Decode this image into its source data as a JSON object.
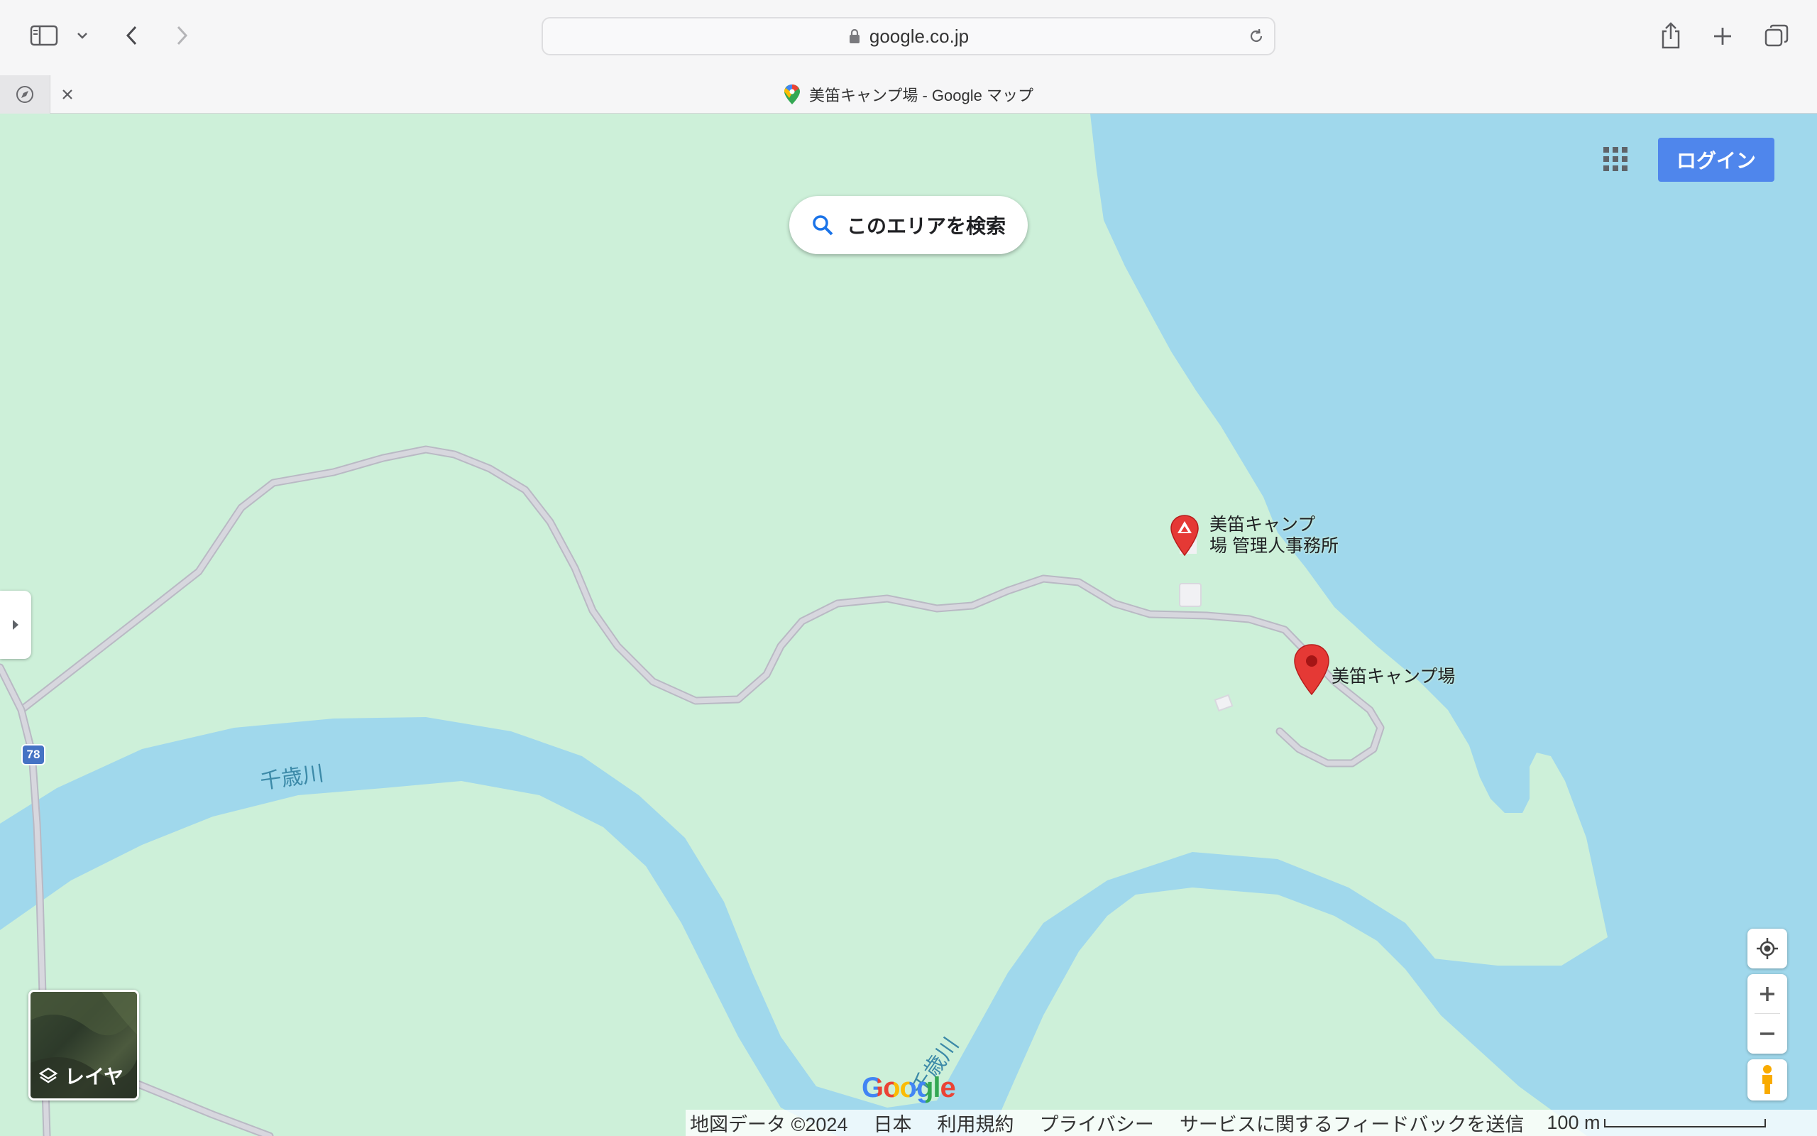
{
  "browser": {
    "url": "google.co.jp",
    "tab_title": "美笛キャンプ場 - Google マップ"
  },
  "map": {
    "search_area_label": "このエリアを検索",
    "login_label": "ログイン",
    "places": [
      {
        "name_line1": "美笛キャンプ",
        "name_line2": "場 管理人事務所"
      },
      {
        "name": "美笛キャンプ場"
      }
    ],
    "route_shield": "78",
    "river_label_1": "千歳川",
    "river_label_2": "千歳川",
    "layer_label": "レイヤ",
    "google_logo": "Google"
  },
  "footer": {
    "map_data": "地図データ ©2024",
    "country": "日本",
    "terms": "利用規約",
    "privacy": "プライバシー",
    "feedback": "サービスに関するフィードバックを送信",
    "scale": "100 m"
  },
  "colors": {
    "land": "#cdf0d9",
    "water": "#a0d8ec",
    "road": "#c8c8d0",
    "marker": "#e53935",
    "login_bg": "#4f86ec"
  }
}
